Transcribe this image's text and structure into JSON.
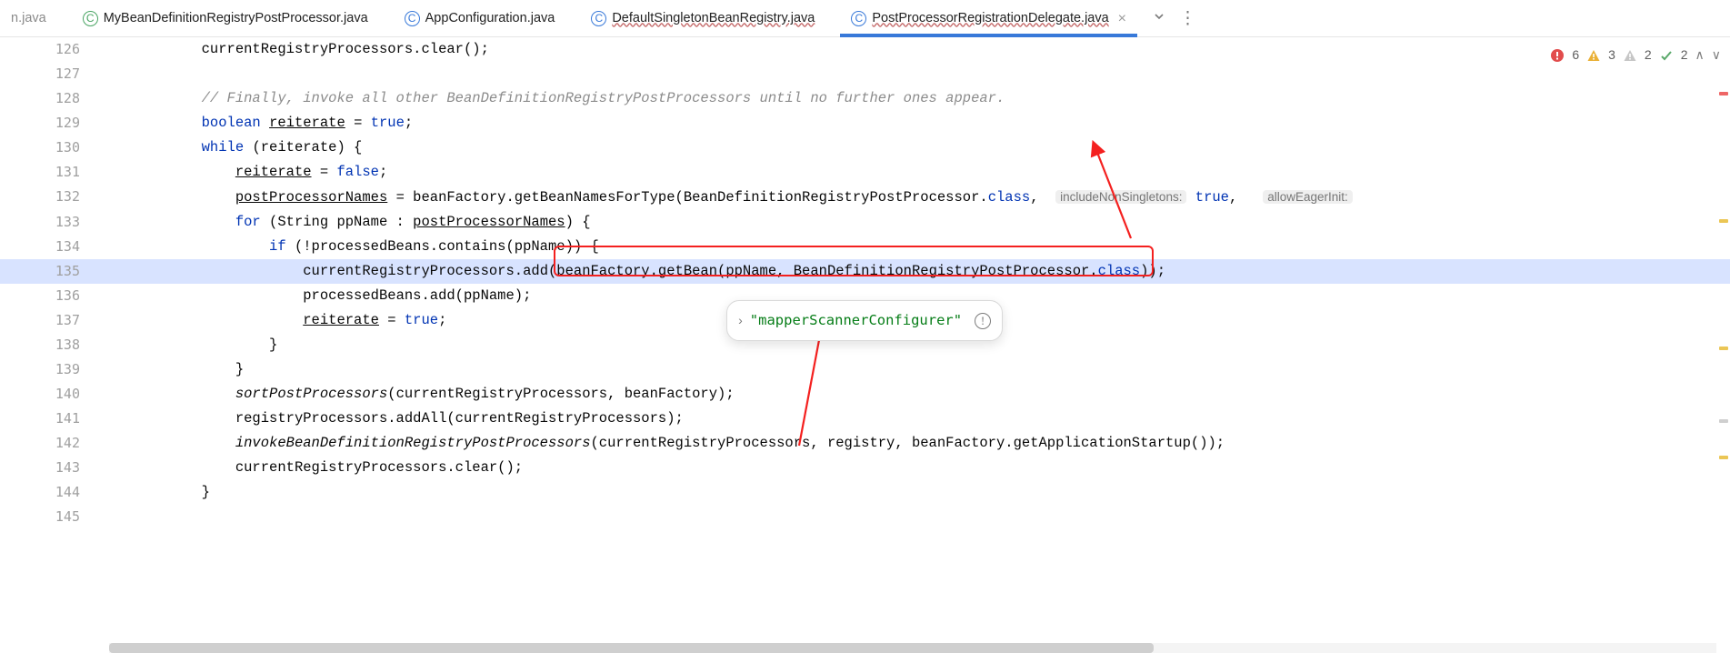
{
  "tabs": [
    {
      "suffix": "n.java",
      "icon": "C",
      "iconColor": "green"
    },
    {
      "label": "MyBeanDefinitionRegistryPostProcessor.java",
      "icon": "C",
      "iconColor": "green",
      "underline": false
    },
    {
      "label": "AppConfiguration.java",
      "icon": "C",
      "iconColor": "blue",
      "underline": false
    },
    {
      "label": "DefaultSingletonBeanRegistry.java",
      "icon": "C",
      "iconColor": "blue",
      "underline": true
    },
    {
      "label": "PostProcessorRegistrationDelegate.java",
      "icon": "C",
      "iconColor": "blue",
      "underline": true,
      "active": true,
      "closeable": true
    }
  ],
  "inspections": {
    "errors": 6,
    "warnings": 3,
    "weakWarnings": 2,
    "typos": 2
  },
  "firstLine": 126,
  "indentWidth": 4,
  "code": {
    "l126": "currentRegistryProcessors.clear();",
    "l128": "// Finally, invoke all other BeanDefinitionRegistryPostProcessors until no further ones appear.",
    "l129_kw": "boolean",
    "l129_var": "reiterate",
    "l129_eq": " = ",
    "l129_val": "true",
    "l130_kw": "while",
    "l130_body": " (reiterate) {",
    "l131_var": "reiterate",
    "l131_rest": " = ",
    "l131_val": "false",
    "l132_var": "postProcessorNames",
    "l132_mid": " = beanFactory.getBeanNamesForType(BeanDefinitionRegistryPostProcessor.",
    "l132_cls": "class",
    "l132_hint1": "includeNonSingletons:",
    "l132_true": "true",
    "l132_hint2": "allowEagerInit:",
    "l133_for": "for",
    "l133_body_a": " (String ppName : ",
    "l133_var": "postProcessorNames",
    "l133_body_b": ") {",
    "l134_if": "if",
    "l134_body": " (!processedBeans.contains(ppName)) {",
    "l135_a": "currentRegistryProcessors.add(",
    "l135_b": "beanFactory.getBean(ppName, BeanDefinitionRegistryPostProcessor.",
    "l135_cls": "class",
    "l135_c": ")",
    "l135_d": ");",
    "l136": "processedBeans.add(ppName);",
    "l137_var": "reiterate",
    "l137_rest": " = ",
    "l137_val": "true",
    "l138": "}",
    "l139": "}",
    "l140_fn": "sortPostProcessors",
    "l140_rest": "(currentRegistryProcessors, beanFactory);",
    "l141": "registryProcessors.addAll(currentRegistryProcessors);",
    "l142_fn": "invokeBeanDefinitionRegistryPostProcessors",
    "l142_rest": "(currentRegistryProcessors, registry, beanFactory.getApplicationStartup());",
    "l143": "currentRegistryProcessors.clear();",
    "l144": "}"
  },
  "tooltip": {
    "value": "\"mapperScannerConfigurer\""
  }
}
